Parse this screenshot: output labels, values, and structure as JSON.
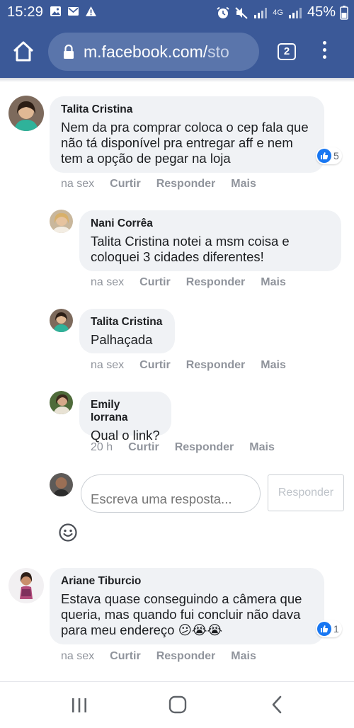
{
  "status_bar": {
    "time": "15:29",
    "network": "4G",
    "battery": "45%",
    "left_icons": [
      "image-icon",
      "mail-icon",
      "warning-icon"
    ],
    "right_icons": [
      "alarm-icon",
      "mute-icon",
      "signal-icon",
      "battery-icon"
    ]
  },
  "browser": {
    "url_domain": "m.facebook.com/",
    "url_path": "sto",
    "tab_count": "2"
  },
  "comments": [
    {
      "author": "Talita Cristina",
      "text": "Nem da pra comprar coloca o cep fala que não tá disponível pra entregar aff e nem tem a opção de pegar na loja",
      "time": "na sex",
      "like": "Curtir",
      "reply": "Responder",
      "more": "Mais",
      "reaction_count": "5"
    },
    {
      "author": "Ariane Tiburcio",
      "text": "Estava quase conseguindo a câmera que queria, mas quando fui concluir não dava para meu endereço 😕😭😭",
      "time": "na sex",
      "like": "Curtir",
      "reply": "Responder",
      "more": "Mais",
      "reaction_count": "1"
    }
  ],
  "replies": [
    {
      "author": "Nani Corrêa",
      "text": "Talita Cristina notei a msm coisa e coloquei 3 cidades diferentes!",
      "time": "na sex",
      "like": "Curtir",
      "reply": "Responder",
      "more": "Mais"
    },
    {
      "author": "Talita Cristina",
      "text": "Palhaçada",
      "time": "na sex",
      "like": "Curtir",
      "reply": "Responder",
      "more": "Mais"
    },
    {
      "author": "Emily Iorrana",
      "text": "Qual o link?",
      "time": "20 h",
      "like": "Curtir",
      "reply": "Responder",
      "more": "Mais"
    }
  ],
  "composer": {
    "placeholder": "Escreva uma resposta...",
    "submit_label": "Responder"
  },
  "colors": {
    "brand": "#3b5998",
    "bubble": "#f0f2f5",
    "meta_text": "#90949c",
    "like_blue": "#1877f2"
  }
}
